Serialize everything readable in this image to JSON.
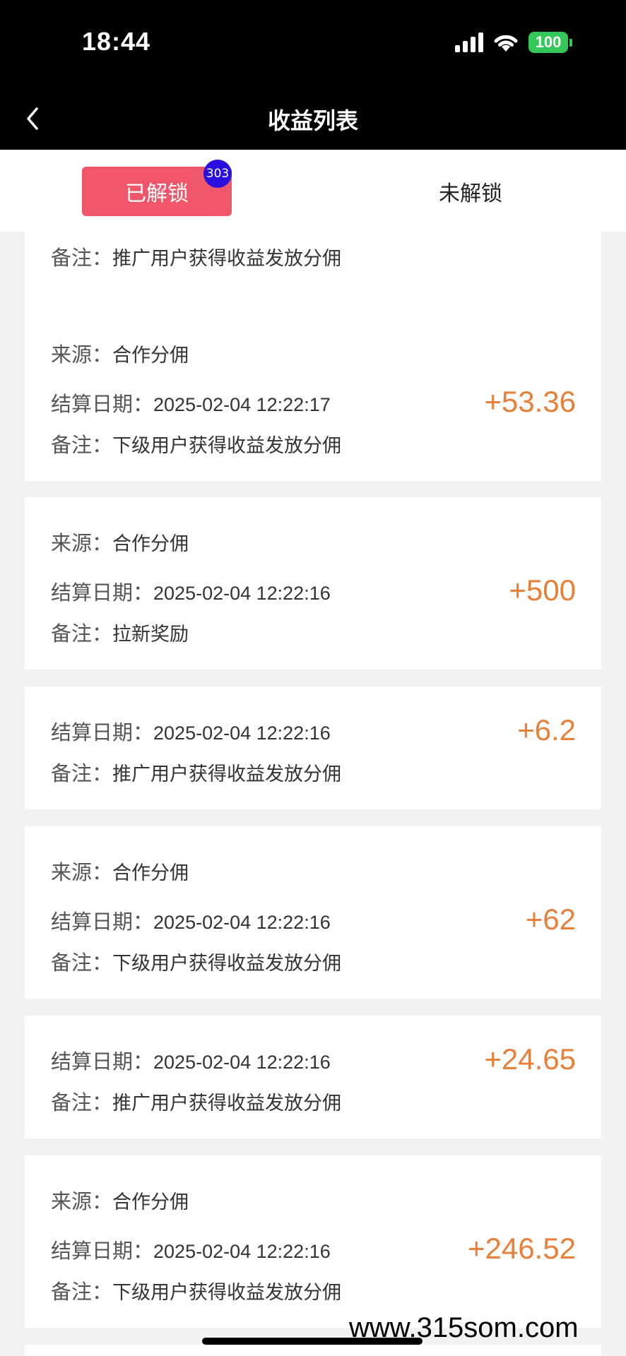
{
  "status": {
    "time": "18:44",
    "battery": "100"
  },
  "nav": {
    "title": "收益列表"
  },
  "tabs": {
    "unlocked_label": "已解锁",
    "unlocked_count": "303",
    "locked_label": "未解锁"
  },
  "labels": {
    "source": "来源：",
    "date": "结算日期：",
    "note": "备注："
  },
  "entries": [
    {
      "note": "推广用户获得收益发放分佣"
    },
    {
      "source": "合作分佣",
      "date": "2025-02-04 12:22:17",
      "note": "下级用户获得收益发放分佣",
      "amount": "+53.36"
    },
    {
      "source": "合作分佣",
      "date": "2025-02-04 12:22:16",
      "note": "拉新奖励",
      "amount": "+500"
    },
    {
      "date": "2025-02-04 12:22:16",
      "note": "推广用户获得收益发放分佣",
      "amount": "+6.2"
    },
    {
      "source": "合作分佣",
      "date": "2025-02-04 12:22:16",
      "note": "下级用户获得收益发放分佣",
      "amount": "+62"
    },
    {
      "date": "2025-02-04 12:22:16",
      "note": "推广用户获得收益发放分佣",
      "amount": "+24.65"
    },
    {
      "source": "合作分佣",
      "date": "2025-02-04 12:22:16",
      "note": "下级用户获得收益发放分佣",
      "amount": "+246.52"
    }
  ],
  "watermark": "www.315som.com",
  "colors": {
    "accent": "#f0566a",
    "amount": "#e8803a",
    "badge": "#2a0fe0",
    "battery": "#34c759"
  }
}
